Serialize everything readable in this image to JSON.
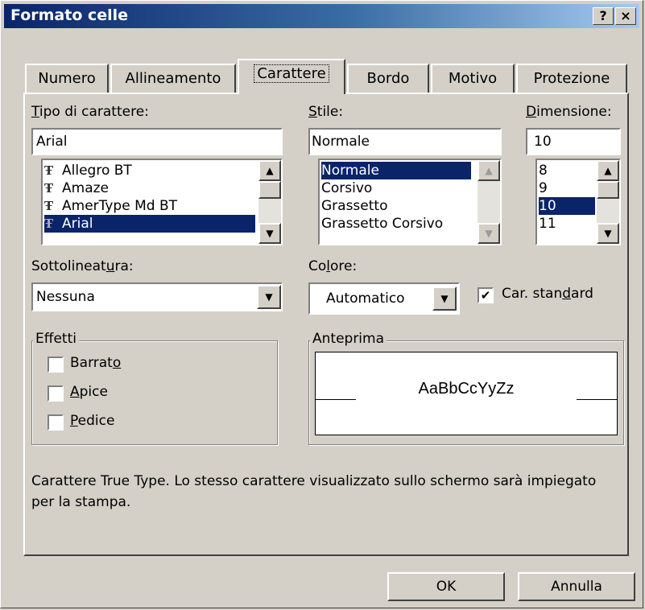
{
  "window": {
    "title": "Formato celle",
    "help_label": "?",
    "close_label": "×"
  },
  "tabs": [
    {
      "label": "Numero"
    },
    {
      "label": "Allineamento"
    },
    {
      "label": "Carattere"
    },
    {
      "label": "Bordo"
    },
    {
      "label": "Motivo"
    },
    {
      "label": "Protezione"
    }
  ],
  "active_tab": "Carattere",
  "font": {
    "label_u": "T",
    "label_rest": "ipo di carattere:",
    "value": "Arial",
    "items": [
      "Allegro BT",
      "Amaze",
      "AmerType Md BT",
      "Arial"
    ],
    "selected": "Arial",
    "item_icon": "truetype-icon"
  },
  "style": {
    "label_u": "S",
    "label_rest": "tile:",
    "value": "Normale",
    "items": [
      "Normale",
      "Corsivo",
      "Grassetto",
      "Grassetto Corsivo"
    ],
    "selected": "Normale"
  },
  "size": {
    "label_u": "D",
    "label_rest": "imensione:",
    "value": "10",
    "items": [
      "8",
      "9",
      "10",
      "11"
    ],
    "selected": "10"
  },
  "underline": {
    "label_a": "Sottolineat",
    "label_u": "u",
    "label_b": "ra:",
    "value": "Nessuna"
  },
  "color": {
    "label_a": "Co",
    "label_u": "l",
    "label_b": "ore:",
    "value": "Automatico"
  },
  "standard": {
    "label_a": "Car. stan",
    "label_u": "d",
    "label_b": "ard",
    "checked": true
  },
  "effects": {
    "title": "Effetti",
    "items": [
      {
        "a": "Barrat",
        "u": "o",
        "b": "",
        "checked": false
      },
      {
        "a": "",
        "u": "A",
        "b": "pice",
        "checked": false
      },
      {
        "a": "",
        "u": "P",
        "b": "edice",
        "checked": false
      }
    ]
  },
  "preview": {
    "title": "Anteprima",
    "sample": "AaBbCcYyZz"
  },
  "info": "Carattere True Type. Lo stesso carattere visualizzato sullo schermo sarà impiegato per la stampa.",
  "buttons": {
    "ok": "OK",
    "cancel": "Annulla"
  },
  "colors": {
    "titlebar_start": "#0a246a",
    "titlebar_end": "#a6caf0",
    "selection": "#0a246a",
    "face": "#d4d0c8"
  }
}
